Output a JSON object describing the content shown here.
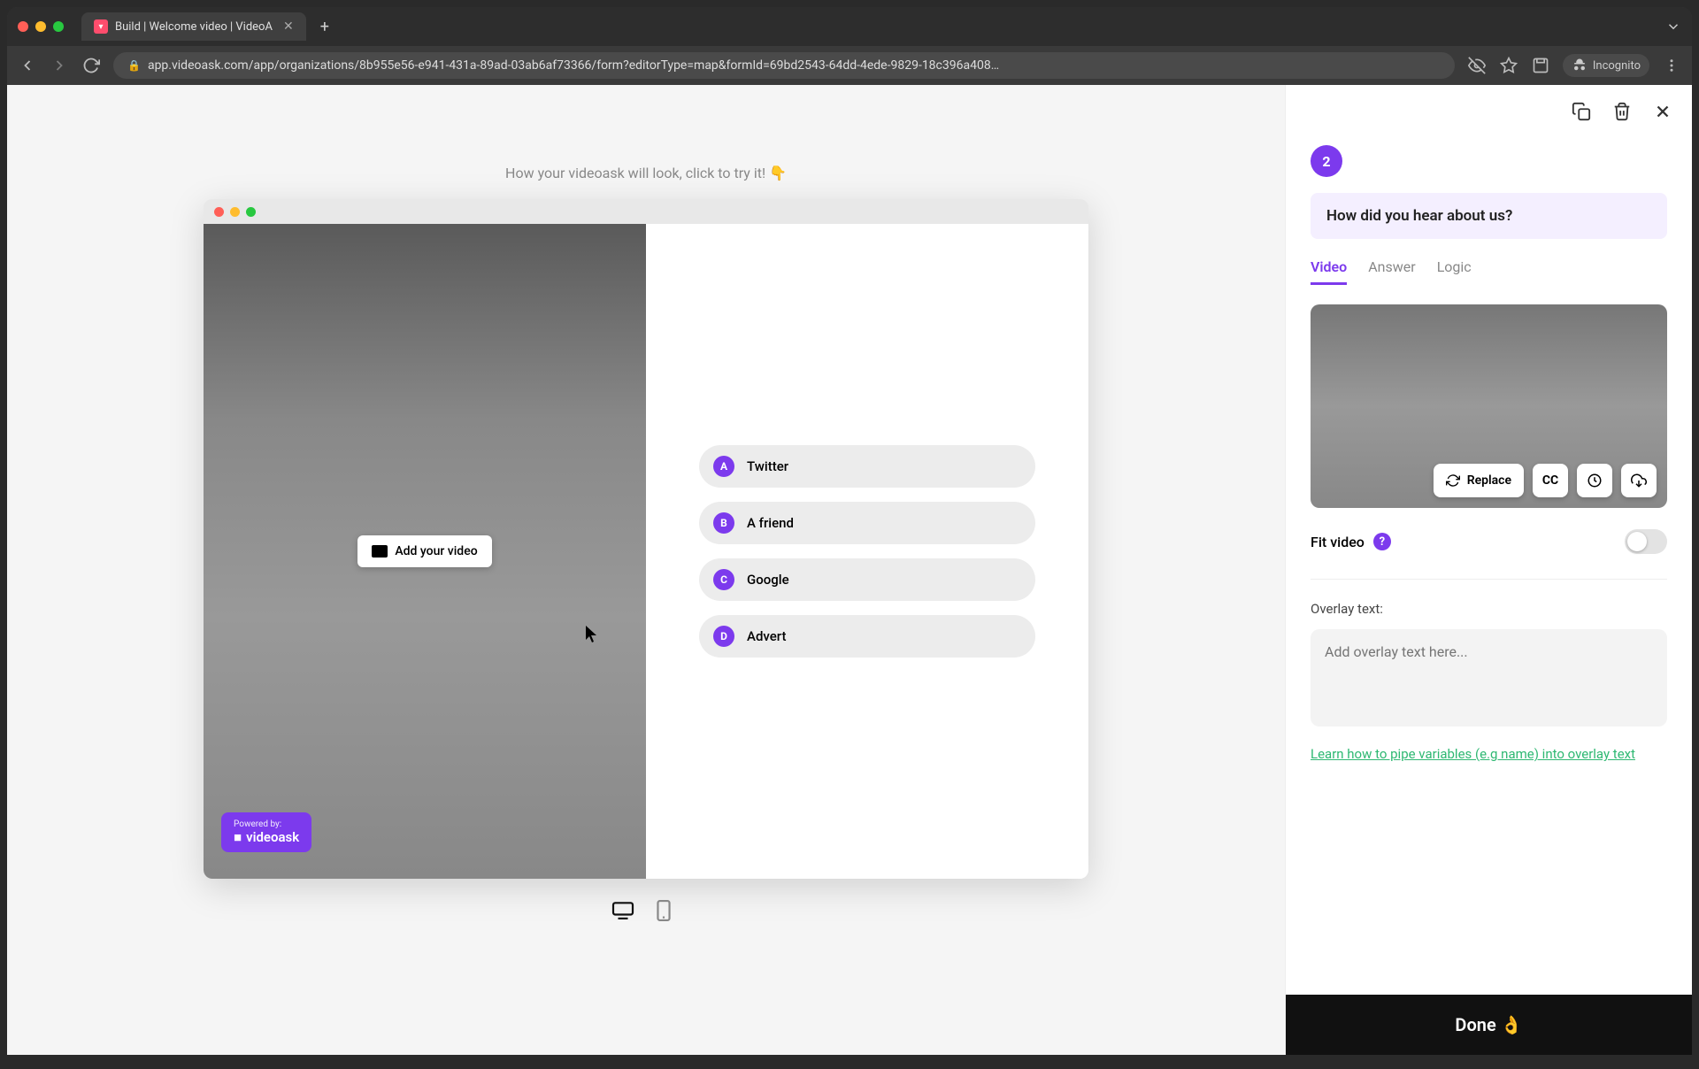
{
  "browser": {
    "tab_title": "Build | Welcome video | VideoA",
    "url": "app.videoask.com/app/organizations/8b955e56-e941-431a-89ad-03ab6af73366/form?editorType=map&formId=69bd2543-64dd-4ede-9829-18c396a408…",
    "incognito_label": "Incognito"
  },
  "preview": {
    "caption": "How your videoask will look, click to try it! 👇",
    "add_video_label": "Add your video",
    "powered_by_prefix": "Powered by:",
    "powered_by_brand": "videoask",
    "options": [
      {
        "letter": "A",
        "label": "Twitter"
      },
      {
        "letter": "B",
        "label": "A friend"
      },
      {
        "letter": "C",
        "label": "Google"
      },
      {
        "letter": "D",
        "label": "Advert"
      }
    ]
  },
  "sidebar": {
    "step_number": "2",
    "question": "How did you hear about us?",
    "tabs": {
      "video": "Video",
      "answer": "Answer",
      "logic": "Logic"
    },
    "replace_label": "Replace",
    "cc_label": "CC",
    "fit_video_label": "Fit video",
    "overlay_label": "Overlay text:",
    "overlay_placeholder": "Add overlay text here...",
    "learn_link": "Learn how to pipe variables (e.g name) into overlay text",
    "done_label": "Done 👌"
  }
}
